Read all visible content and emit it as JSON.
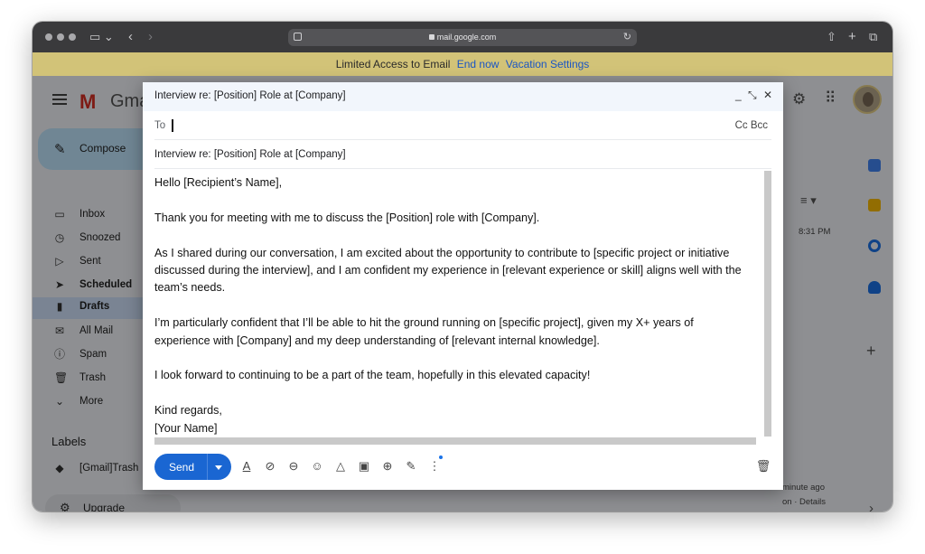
{
  "browser": {
    "url": "mail.google.com"
  },
  "banner": {
    "text": "Limited Access to Email",
    "end_now": "End now",
    "vacation_settings": "Vacation Settings"
  },
  "gmail": {
    "logo_text": "Gma",
    "compose_label": "Compose",
    "nav": [
      {
        "label": "Inbox",
        "icon": "inbox-icon"
      },
      {
        "label": "Snoozed",
        "icon": "clock-icon"
      },
      {
        "label": "Sent",
        "icon": "send-icon"
      },
      {
        "label": "Scheduled",
        "icon": "scheduled-icon"
      },
      {
        "label": "Drafts",
        "icon": "draft-icon"
      },
      {
        "label": "All Mail",
        "icon": "all-mail-icon"
      },
      {
        "label": "Spam",
        "icon": "spam-icon"
      },
      {
        "label": "Trash",
        "icon": "trash-icon"
      },
      {
        "label": "More",
        "icon": "chevron-down-icon"
      }
    ],
    "labels_heading": "Labels",
    "label_items": [
      "[Gmail]Trash"
    ],
    "upgrade_label": "Upgrade",
    "list_time": "8:31 PM",
    "footer_time": "minute ago",
    "footer_details": "on · Details"
  },
  "compose": {
    "window_title": "Interview re: [Position] Role at [Company]",
    "to_label": "To",
    "cc_bcc": "Cc Bcc",
    "subject": "Interview re: [Position] Role at [Company]",
    "body": {
      "greeting": "Hello [Recipient’s Name],",
      "p1": "Thank you for meeting with me to discuss the [Position] role with [Company].",
      "p2_l1": "As I shared during our conversation, I am excited about the opportunity to contribute to [specific project or initiative",
      "p2_l2": "discussed during the interview], and I am confident my experience in [relevant experience or skill] aligns well with the",
      "p2_l3": "team’s needs.",
      "p3_l1": "I’m particularly confident that I’ll be able to hit the ground running on [specific project], given my X+ years of",
      "p3_l2": "experience with [Company] and my deep understanding of [relevant internal knowledge].",
      "p4": "I look forward to continuing to be a part of the team, hopefully in this elevated capacity!",
      "closing": "Kind regards,",
      "signature": "[Your Name]"
    },
    "send_label": "Send"
  },
  "colors": {
    "send_button": "#1a66d2",
    "banner_bg": "#d2c378",
    "banner_link": "#1a55c4",
    "compose_header": "#f2f6fc"
  }
}
